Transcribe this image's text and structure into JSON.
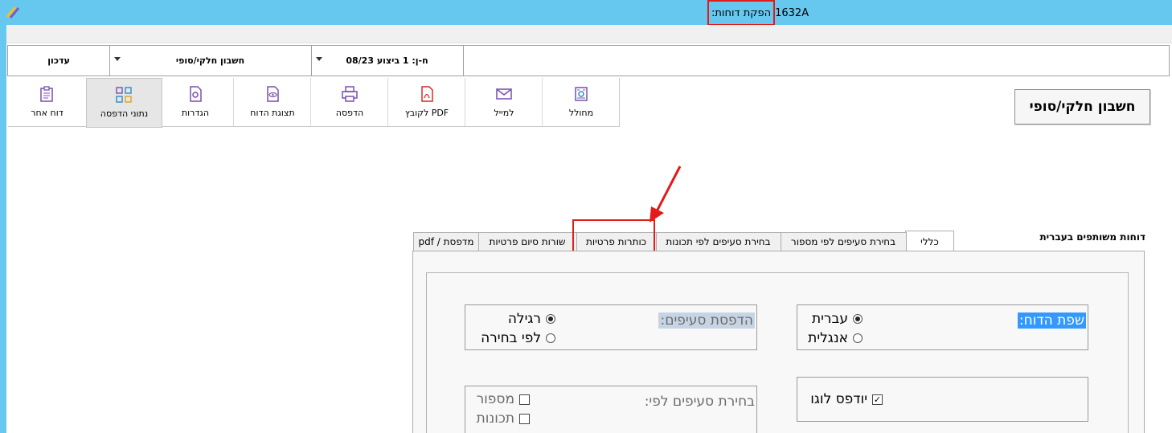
{
  "title_bar": {
    "title": "הפקת דוחות:",
    "code": "1632A"
  },
  "selectors": {
    "refresh": "עדכון",
    "report_type": "חשבון חלקי/סופי",
    "account": "ח-ן: 1 ביצוע 08/23"
  },
  "toolbar": {
    "buttons": [
      {
        "label": "מחולל",
        "icon": "generator-icon"
      },
      {
        "label": "למייל",
        "icon": "mail-icon"
      },
      {
        "label": "PDF לקובץ",
        "icon": "pdf-icon"
      },
      {
        "label": "הדפסה",
        "icon": "printer-icon"
      },
      {
        "label": "תצוגת הדוח",
        "icon": "preview-icon"
      },
      {
        "label": "הגדרות",
        "icon": "settings-icon"
      },
      {
        "label": "נתוני הדפסה",
        "icon": "grid-icon"
      },
      {
        "label": "דוח אחר",
        "icon": "clipboard-icon"
      }
    ]
  },
  "report_title": "חשבון חלקי/סופי",
  "shared_reports_label": "דוחות משותפים בעברית",
  "tabs": [
    {
      "label": "כללי",
      "active": true
    },
    {
      "label": "בחירת סעיפים לפי מספור"
    },
    {
      "label": "בחירת סעיפים לפי תכונות"
    },
    {
      "label": "כותרות פרטיות"
    },
    {
      "label": "שורות סיום פרטיות"
    },
    {
      "label": "מדפסת / pdf"
    }
  ],
  "general_tab": {
    "report_language": {
      "title": "שפת הדוח:",
      "options": [
        "עברית",
        "אנגלית"
      ],
      "selected": "עברית"
    },
    "section_printing": {
      "title": "הדפסת סעיפים:",
      "options": [
        "רגילה",
        "לפי בחירה"
      ],
      "selected": "רגילה"
    },
    "print_logo": {
      "label": "יודפס לוגו",
      "checked": true
    },
    "section_selection": {
      "title": "בחירת סעיפים לפי:",
      "options": [
        {
          "label": "מספור",
          "checked": false
        },
        {
          "label": "תכונות",
          "checked": false
        }
      ]
    }
  },
  "colors": {
    "titlebar": "#66c8ee",
    "highlight_red": "#e21b1b",
    "selected_label_bg": "#3399ff",
    "disabled_label_bg": "#c7d4e4"
  }
}
